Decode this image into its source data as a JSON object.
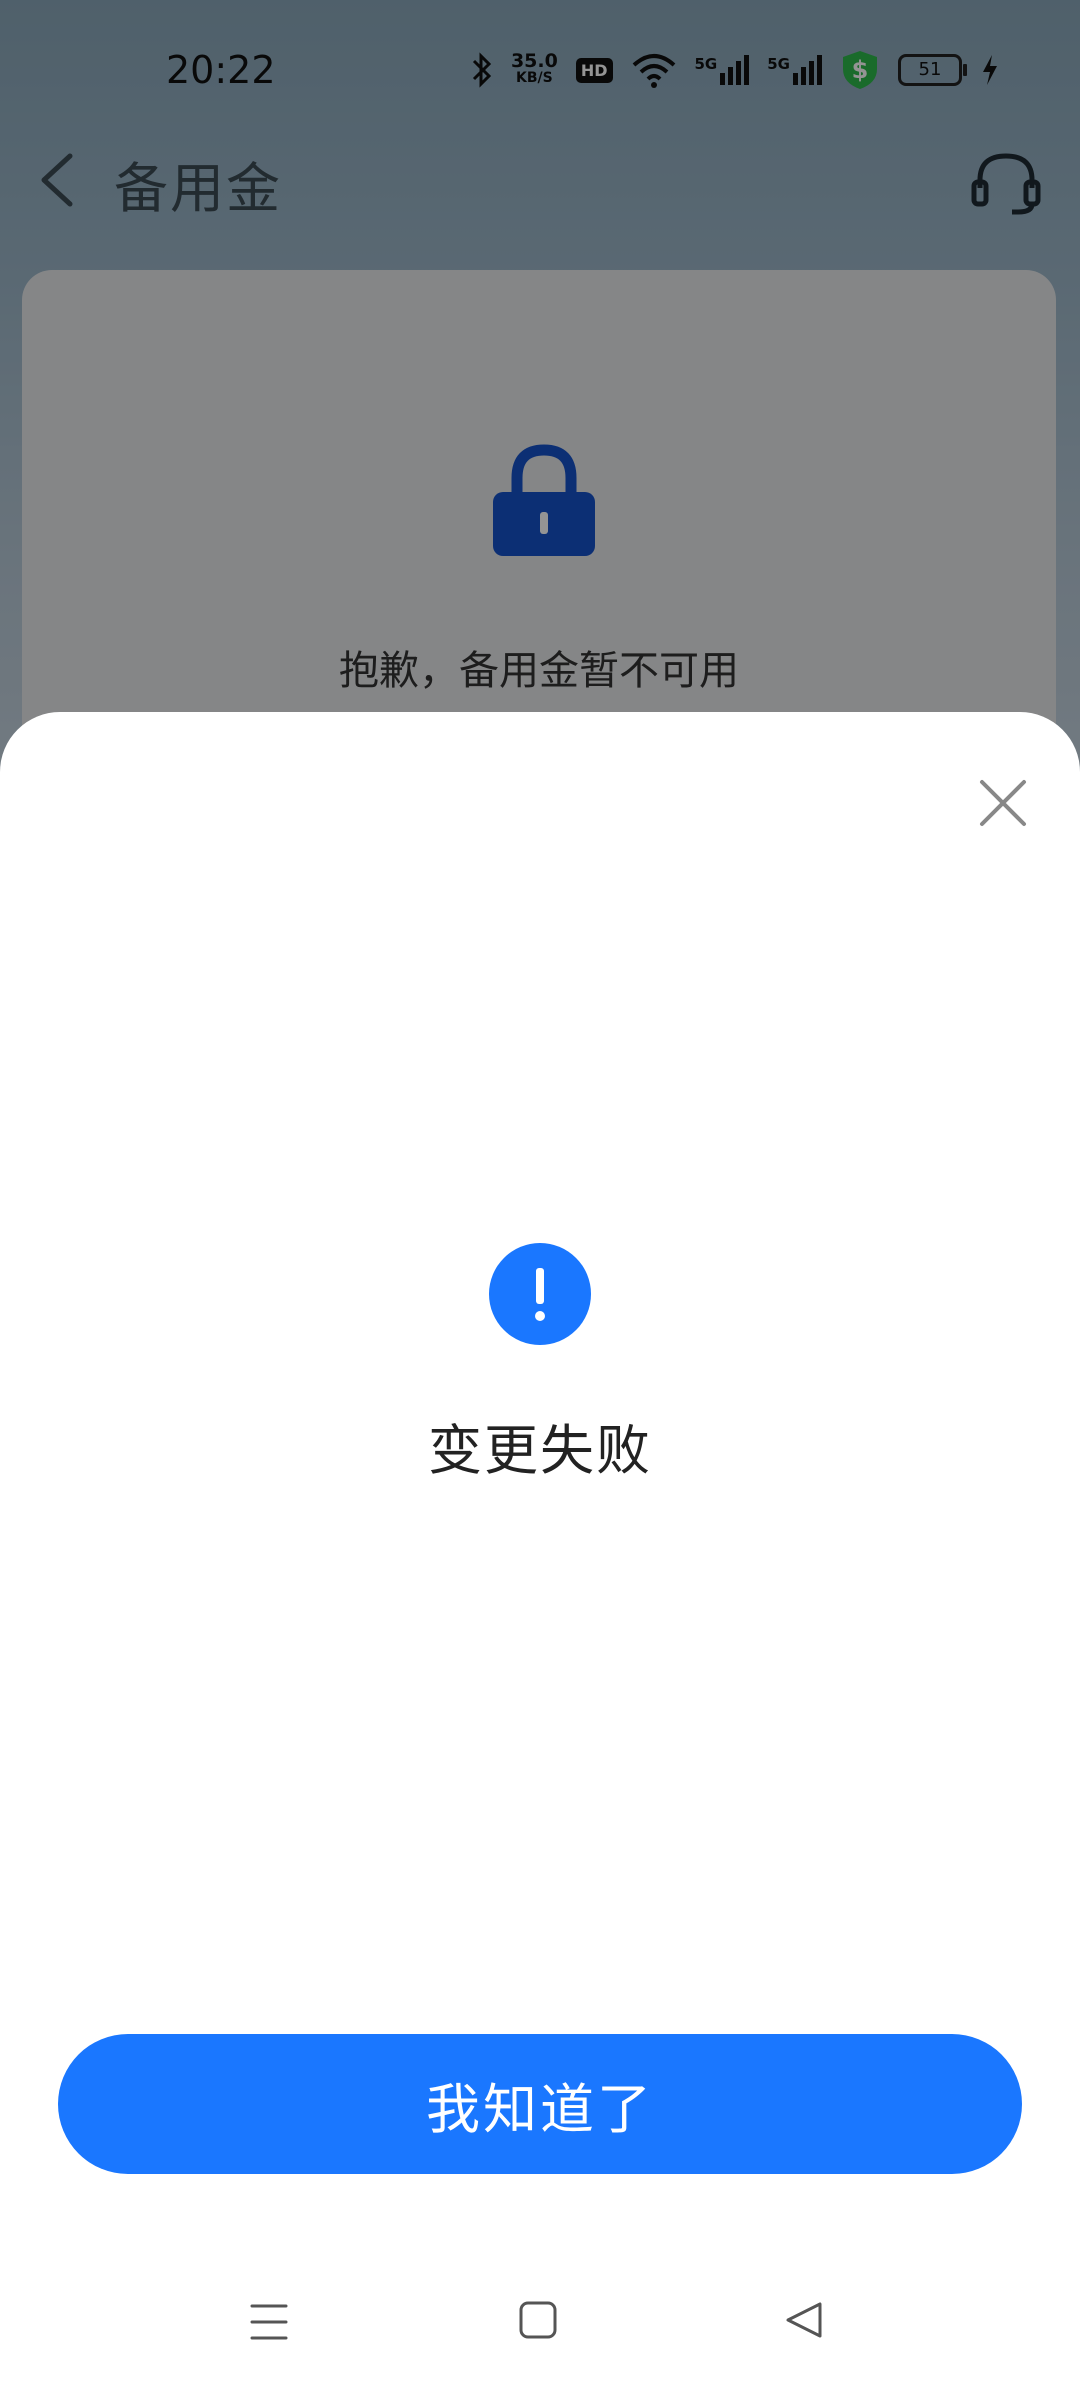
{
  "status_bar": {
    "time": "20:22",
    "net_speed_value": "35.0",
    "net_speed_unit": "KB/S",
    "hd_label": "HD",
    "signal_1_label": "5G",
    "signal_2_label": "5G",
    "battery_level": "51",
    "icons": [
      "bluetooth-icon",
      "hd-icon",
      "wifi-icon",
      "signal-5g-icon",
      "signal-5g-icon",
      "shield-dollar-icon",
      "battery-icon",
      "charging-icon"
    ]
  },
  "header": {
    "title": "备用金",
    "back_icon": "chevron-left-icon",
    "support_icon": "headset-icon"
  },
  "card": {
    "icon": "lock-icon",
    "message": "抱歉，备用金暂不可用"
  },
  "sheet": {
    "close_icon": "close-icon",
    "status_icon": "alert-icon",
    "title": "变更失败",
    "confirm_label": "我知道了"
  },
  "nav_bar": {
    "icons": [
      "menu-icon",
      "home-icon",
      "back-triangle-icon"
    ]
  },
  "colors": {
    "accent": "#1a77ff",
    "lock": "#1552c9",
    "sheet_bg": "#ffffff"
  }
}
